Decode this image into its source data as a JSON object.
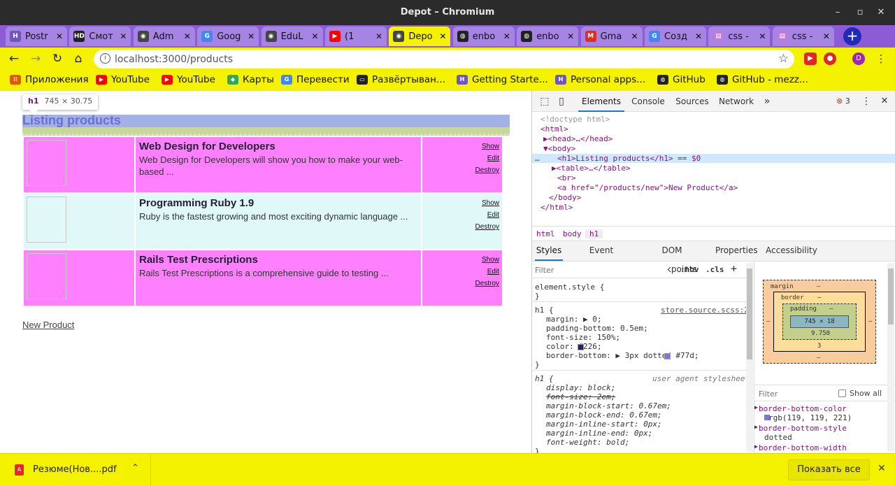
{
  "window": {
    "title": "Depot – Chromium"
  },
  "tabs": [
    {
      "label": "Postr",
      "icon": "heroku-icon",
      "color": "#7056bf"
    },
    {
      "label": "Смот",
      "icon": "hd-icon",
      "color": "#222222"
    },
    {
      "label": "Adm",
      "icon": "globe-icon",
      "color": "#444444"
    },
    {
      "label": "Goog",
      "icon": "translate-icon",
      "color": "#4285f4"
    },
    {
      "label": "EduL",
      "icon": "globe-icon",
      "color": "#444444"
    },
    {
      "label": "(1",
      "icon": "youtube-icon",
      "color": "#ff0000"
    },
    {
      "label": "Depo",
      "icon": "globe-icon",
      "color": "#444444",
      "active": true
    },
    {
      "label": "enbo",
      "icon": "github-icon",
      "color": "#222222"
    },
    {
      "label": "enbo",
      "icon": "github-icon",
      "color": "#222222"
    },
    {
      "label": "Gma",
      "icon": "gmail-icon",
      "color": "#d93025"
    },
    {
      "label": "Созд",
      "icon": "google-icon",
      "color": "#4285f4"
    },
    {
      "label": "css -",
      "icon": "stackoverflow-icon",
      "color": "#bc7cdc"
    },
    {
      "label": "css -",
      "icon": "stackoverflow-icon",
      "color": "#bc7cdc"
    }
  ],
  "address": {
    "url": "localhost:3000/products"
  },
  "bookmarks": [
    {
      "label": "Приложения",
      "icon": "apps-grid-icon",
      "color": "#e05a00"
    },
    {
      "label": "YouTube",
      "icon": "youtube-icon",
      "color": "#ff0000"
    },
    {
      "label": "YouTube",
      "icon": "youtube-icon",
      "color": "#ff0000"
    },
    {
      "label": "Карты",
      "icon": "maps-pin-icon",
      "color": "#34a853"
    },
    {
      "label": "Перевести",
      "icon": "translate-icon",
      "color": "#4285f4"
    },
    {
      "label": "Развёртыван...",
      "icon": "chat-bubble-icon",
      "color": "#222222"
    },
    {
      "label": "Getting Starte...",
      "icon": "heroku-icon",
      "color": "#7056bf"
    },
    {
      "label": "Personal apps...",
      "icon": "heroku-icon",
      "color": "#7056bf"
    },
    {
      "label": "GitHub",
      "icon": "github-icon",
      "color": "#222222"
    },
    {
      "label": "GitHub - mezz...",
      "icon": "github-icon",
      "color": "#222222"
    }
  ],
  "inspector_tooltip": {
    "tag": "h1",
    "size": "745 × 30.75"
  },
  "page": {
    "heading": "Listing products",
    "products": [
      {
        "title": "Web Design for Developers",
        "description": "Web Design for Developers will show you how to make your web-based ...",
        "actions": [
          "Show",
          "Edit",
          "Destroy"
        ]
      },
      {
        "title": "Programming Ruby 1.9",
        "description": "Ruby is the fastest growing and most exciting dynamic language ...",
        "actions": [
          "Show",
          "Edit",
          "Destroy"
        ]
      },
      {
        "title": "Rails Test Prescriptions",
        "description": "Rails Test Prescriptions is a comprehensive guide to testing ...",
        "actions": [
          "Show",
          "Edit",
          "Destroy"
        ]
      }
    ],
    "new_link": "New Product"
  },
  "devtools": {
    "tabs": [
      "Elements",
      "Console",
      "Sources",
      "Network"
    ],
    "more": "»",
    "error_count": "3",
    "dom_lines": [
      "<!doctype html>",
      "<html>",
      "▶<head>…</head>",
      "▼<body>",
      "<h1>Listing products</h1> == $0",
      "▶<table>…</table>",
      "<br>",
      "<a href=\"/products/new\">New Product</a>",
      "</body>",
      "</html>"
    ],
    "breadcrumbs": [
      "html",
      "body",
      "h1"
    ],
    "subtabs": [
      "Styles",
      "Event Listeners",
      "DOM Breakpoints",
      "Properties",
      "Accessibility"
    ],
    "filter_placeholder": "Filter",
    "hov": ":hov",
    "cls": ".cls",
    "plus": "+",
    "element_style": "element.style {",
    "close_brace": "}",
    "rule_selector": "h1 {",
    "rule_source": "store.source.scss:2",
    "rule_props": [
      "margin: ▶ 0;",
      "padding-bottom: 0.5em;",
      "font-size: 150%;",
      "color: #226;",
      "border-bottom: ▶ 3px dotted #77d;"
    ],
    "ua_selector": "h1 {",
    "ua_source": "user agent stylesheet",
    "ua_props": [
      "display: block;",
      "font-size: 2em;",
      "margin-block-start: 0.67em;",
      "margin-block-end: 0.67em;",
      "margin-inline-start: 0px;",
      "margin-inline-end: 0px;",
      "font-weight: bold;"
    ],
    "box_model": {
      "margin_label": "margin",
      "border_label": "border",
      "padding_label": "padding",
      "dash": "–",
      "content": "745 × 18",
      "padding_bottom": "9.750",
      "border_bottom": "3"
    },
    "computed_filter": "Filter",
    "show_all": "Show all",
    "computed": [
      {
        "prop": "border-bottom-color",
        "value": "rgb(119, 119, 221)"
      },
      {
        "prop": "border-bottom-style",
        "value": "dotted"
      },
      {
        "prop": "border-bottom-width",
        "value": ""
      }
    ]
  },
  "download_bar": {
    "file": "Резюме(Нов....pdf",
    "show_all": "Показать все"
  }
}
